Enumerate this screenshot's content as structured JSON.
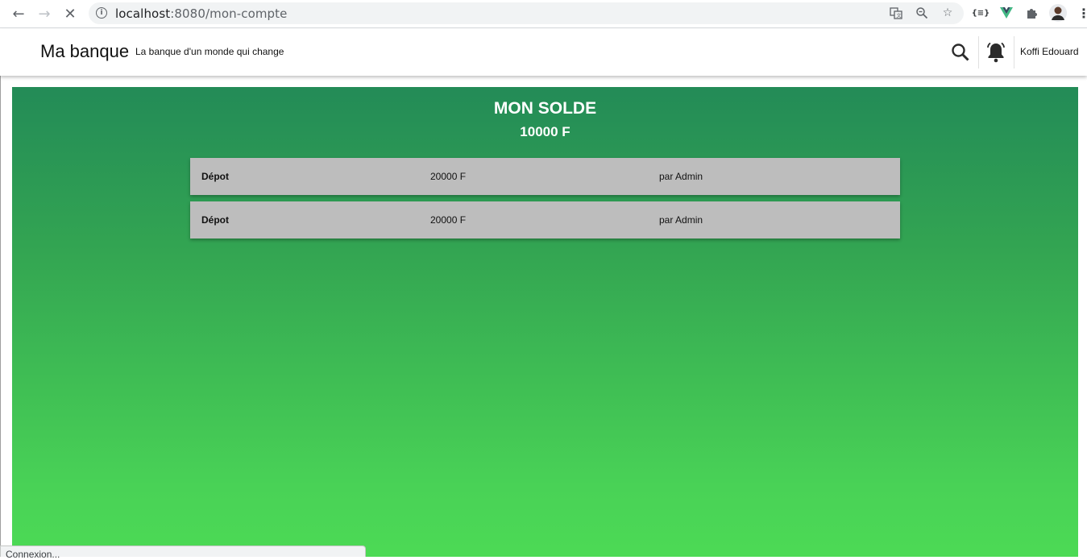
{
  "browser": {
    "url_host": "localhost",
    "url_path": ":8080/mon-compte"
  },
  "header": {
    "title": "Ma banque",
    "subtitle": "La banque d'un monde qui change",
    "user_name": "Koffi Edouard"
  },
  "account": {
    "balance_label": "MON SOLDE",
    "balance_value": "10000 F"
  },
  "transactions": [
    {
      "type": "Dépot",
      "amount": "20000 F",
      "by": "par Admin"
    },
    {
      "type": "Dépot",
      "amount": "20000 F",
      "by": "par Admin"
    }
  ],
  "status_bar": {
    "text": "Connexion..."
  },
  "colors": {
    "panel_top": "#238b57",
    "panel_bottom": "#4cda55",
    "row_bg": "#bdbdbd"
  }
}
